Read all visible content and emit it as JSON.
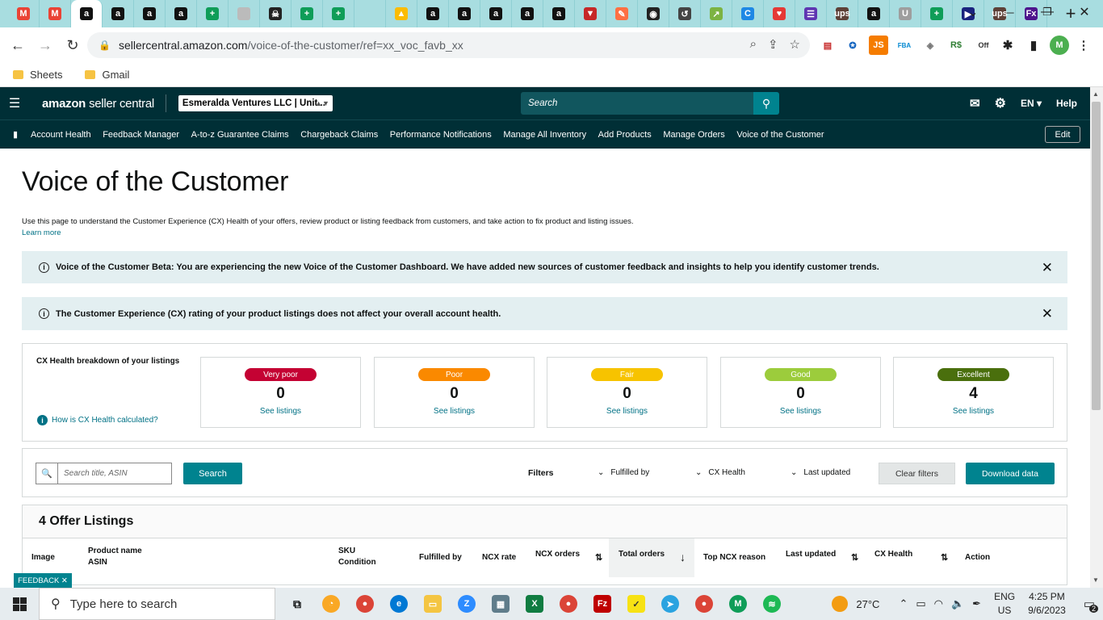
{
  "browser": {
    "tabs": [
      {
        "icon": "gmail-icon",
        "label": "M",
        "color": "#ea4335"
      },
      {
        "icon": "gmail-icon",
        "label": "M",
        "color": "#ea4335"
      },
      {
        "icon": "amazon-icon",
        "label": "a",
        "color": "#111111",
        "active": true
      },
      {
        "icon": "amazon-icon",
        "label": "a",
        "color": "#111111"
      },
      {
        "icon": "amazon-icon",
        "label": "a",
        "color": "#111111"
      },
      {
        "icon": "amazon-icon",
        "label": "a",
        "color": "#111111"
      },
      {
        "icon": "sheets-icon",
        "label": "+",
        "color": "#0f9d58"
      },
      {
        "icon": "globe-icon",
        "label": "",
        "color": "#bbbbbb"
      },
      {
        "icon": "skull-icon",
        "label": "☠",
        "color": "#222222"
      },
      {
        "icon": "sheets-icon",
        "label": "+",
        "color": "#0f9d58"
      },
      {
        "icon": "sheets-icon",
        "label": "+",
        "color": "#0f9d58"
      },
      {
        "icon": "blank-icon",
        "label": "",
        "color": "#a8dde0"
      },
      {
        "icon": "drive-icon",
        "label": "▲",
        "color": "#fbbc04"
      },
      {
        "icon": "amazon-icon",
        "label": "a",
        "color": "#111111"
      },
      {
        "icon": "amazon-icon",
        "label": "a",
        "color": "#111111"
      },
      {
        "icon": "amazon-icon",
        "label": "a",
        "color": "#111111"
      },
      {
        "icon": "amazon-icon",
        "label": "a",
        "color": "#111111"
      },
      {
        "icon": "amazon-icon",
        "label": "a",
        "color": "#111111"
      },
      {
        "icon": "shield-icon",
        "label": "▼",
        "color": "#c62828"
      },
      {
        "icon": "pencil-icon",
        "label": "✎",
        "color": "#ff7043"
      },
      {
        "icon": "circle-icon",
        "label": "◉",
        "color": "#222222"
      },
      {
        "icon": "history-icon",
        "label": "↺",
        "color": "#444444"
      },
      {
        "icon": "chart-icon",
        "label": "↗",
        "color": "#7cb342"
      },
      {
        "icon": "c-icon",
        "label": "C",
        "color": "#1e88e5"
      },
      {
        "icon": "heart-icon",
        "label": "♥",
        "color": "#e53935"
      },
      {
        "icon": "list-icon",
        "label": "☰",
        "color": "#5e35b1"
      },
      {
        "icon": "ups-icon",
        "label": "ups",
        "color": "#5d4037"
      },
      {
        "icon": "amazon-icon",
        "label": "a",
        "color": "#111111"
      },
      {
        "icon": "uline-icon",
        "label": "U",
        "color": "#9e9e9e"
      },
      {
        "icon": "sheets-icon",
        "label": "+",
        "color": "#0f9d58"
      },
      {
        "icon": "usps-icon",
        "label": "▶",
        "color": "#1a237e"
      },
      {
        "icon": "ups-icon",
        "label": "ups",
        "color": "#5d4037"
      },
      {
        "icon": "fedex-icon",
        "label": "Fx",
        "color": "#4d148c"
      }
    ],
    "url_host": "sellercentral.amazon.com",
    "url_path": "/voice-of-the-customer/ref=xx_voc_favb_xx",
    "profile_initial": "M",
    "bookmarks": [
      "Sheets",
      "Gmail"
    ]
  },
  "seller": {
    "logo_brand": "amazon",
    "logo_product": "seller central",
    "account": "Esmeralda Ventures LLC | Unit...",
    "search_placeholder": "Search",
    "language": "EN",
    "help": "Help",
    "nav_links": [
      "Account Health",
      "Feedback Manager",
      "A-to-z Guarantee Claims",
      "Chargeback Claims",
      "Performance Notifications",
      "Manage All Inventory",
      "Add Products",
      "Manage Orders",
      "Voice of the Customer"
    ],
    "edit": "Edit"
  },
  "page": {
    "title": "Voice of the Customer",
    "description": "Use this page to understand the Customer Experience (CX) Health of your offers, review product or listing feedback from customers, and take action to fix product and listing issues.",
    "learn_more": "Learn more",
    "alert1": "Voice of the Customer Beta: You are experiencing the new Voice of the Customer Dashboard. We have added new sources of customer feedback and insights to help you identify customer trends.",
    "alert2": "The Customer Experience (CX) rating of your product listings does not affect your overall account health.",
    "cx_title": "CX Health breakdown of your listings",
    "cx_how": "How is CX Health calculated?",
    "cx_cards": [
      {
        "label": "Very poor",
        "count": "0",
        "link": "See listings",
        "color": "#c40233"
      },
      {
        "label": "Poor",
        "count": "0",
        "link": "See listings",
        "color": "#fa8900"
      },
      {
        "label": "Fair",
        "count": "0",
        "link": "See listings",
        "color": "#f7c300"
      },
      {
        "label": "Good",
        "count": "0",
        "link": "See listings",
        "color": "#9ccc3c"
      },
      {
        "label": "Excellent",
        "count": "4",
        "link": "See listings",
        "color": "#4a6f0d"
      }
    ],
    "filter_search_placeholder": "Search title, ASIN",
    "filter_search_btn": "Search",
    "filters_label": "Filters",
    "filter_fulfilled": "Fulfilled by",
    "filter_cx": "CX Health",
    "filter_updated": "Last updated",
    "clear_filters": "Clear filters",
    "download": "Download data",
    "listings_title": "4 Offer Listings",
    "columns": {
      "image": "Image",
      "product_name": "Product name",
      "asin": "ASIN",
      "sku": "SKU",
      "condition": "Condition",
      "fulfilled_by": "Fulfilled by",
      "ncx_rate": "NCX rate",
      "ncx_orders": "NCX orders",
      "total_orders": "Total orders",
      "top_ncx": "Top NCX reason",
      "last_updated": "Last updated",
      "cx_health": "CX Health",
      "action": "Action"
    },
    "feedback": "FEEDBACK"
  },
  "taskbar": {
    "search_placeholder": "Type here to search",
    "weather": "27°C",
    "lang": "ENG",
    "region": "US",
    "time": "4:25 PM",
    "date": "9/6/2023",
    "notifications": "2"
  }
}
